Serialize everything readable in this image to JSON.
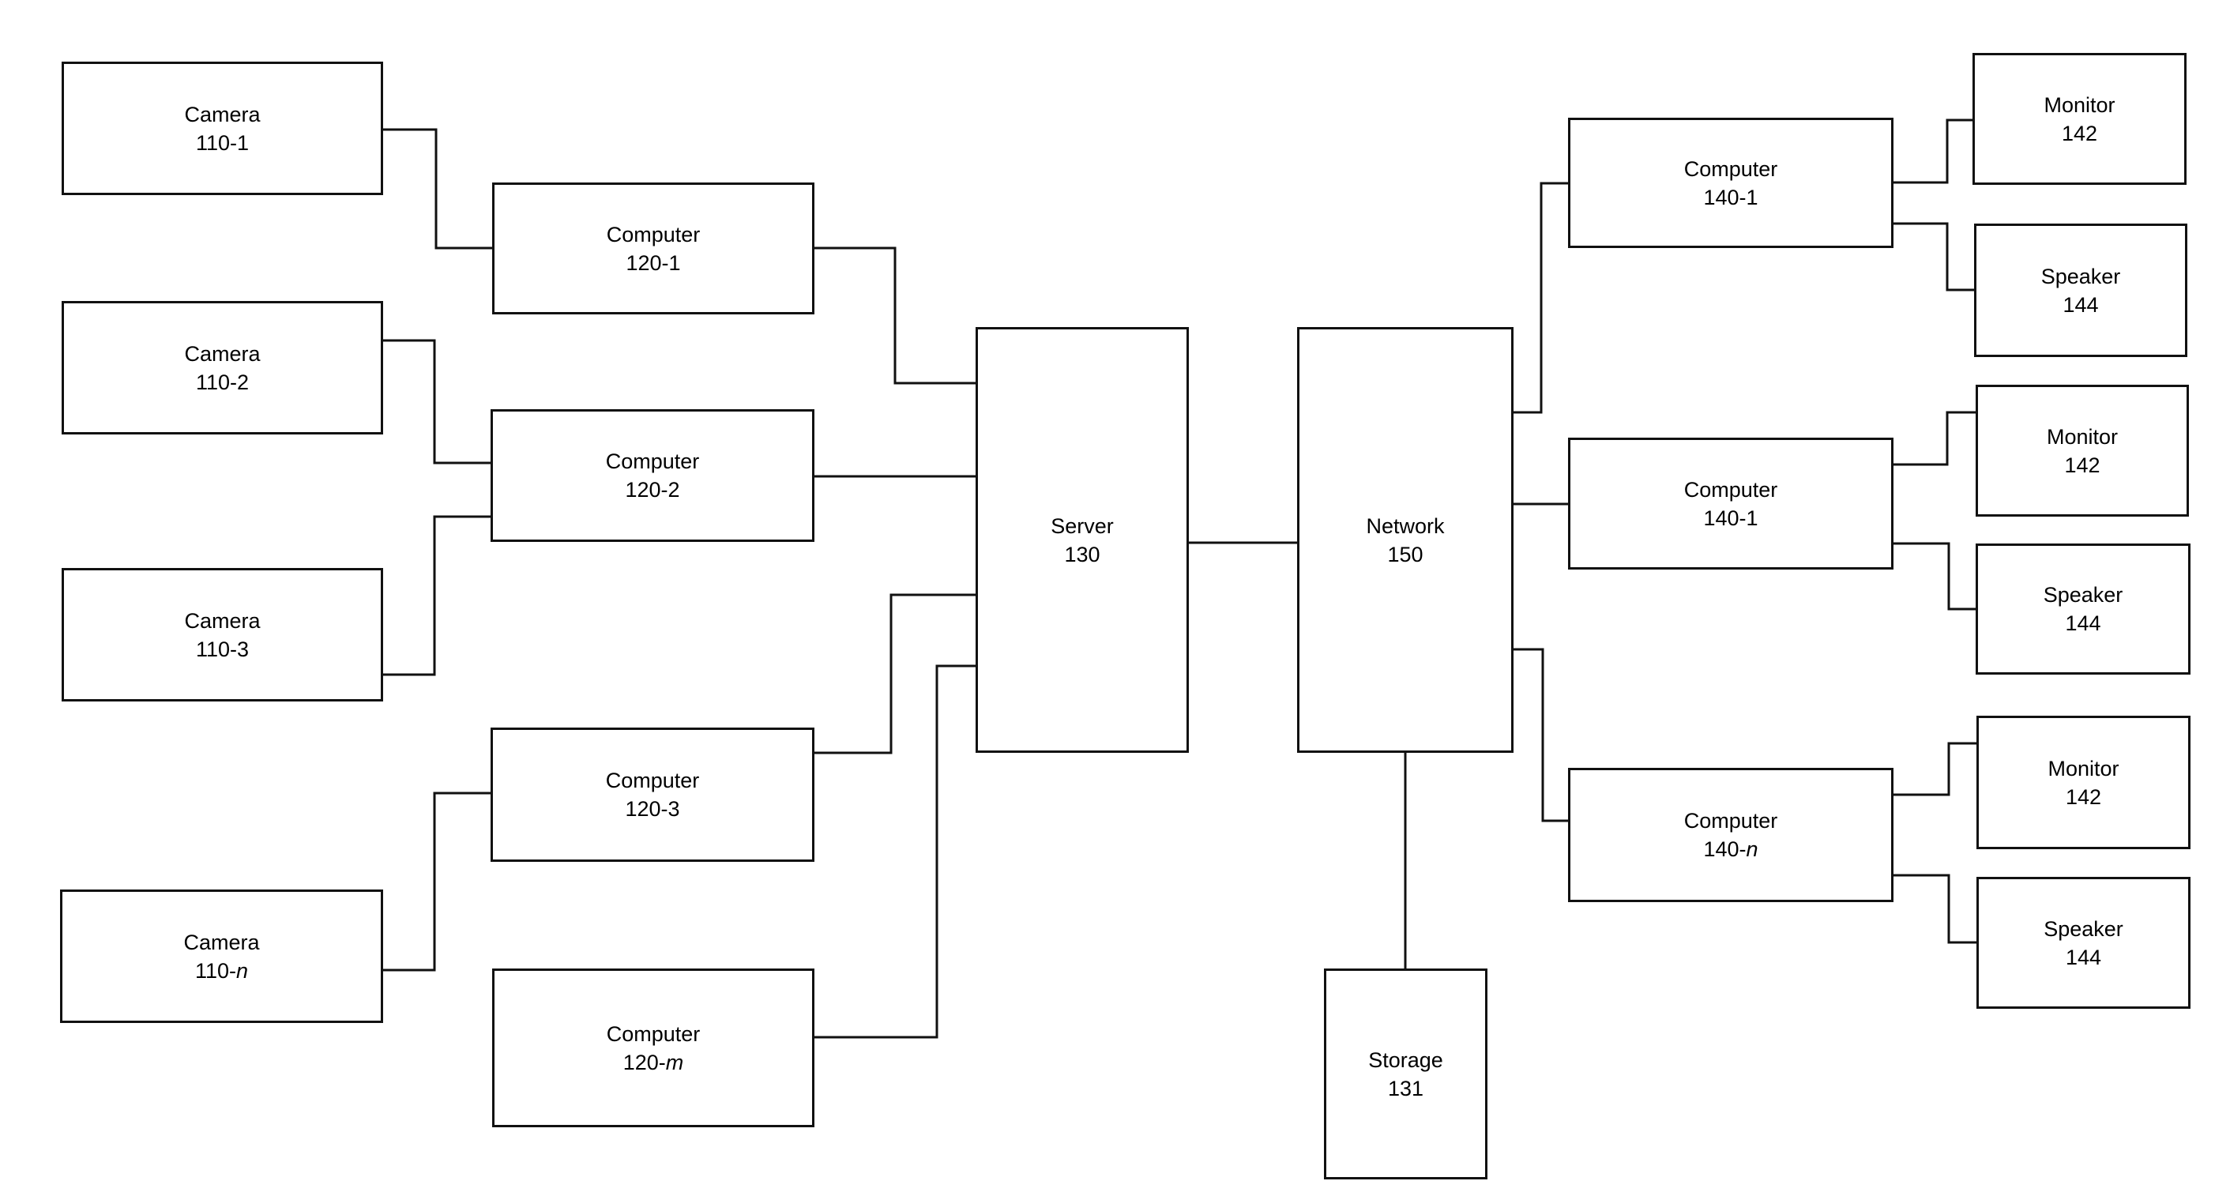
{
  "diagram": {
    "nodes": [
      {
        "id": "camera-110-1",
        "label": "Camera",
        "ref": "110-1"
      },
      {
        "id": "camera-110-2",
        "label": "Camera",
        "ref": "110-2"
      },
      {
        "id": "camera-110-3",
        "label": "Camera",
        "ref": "110-3"
      },
      {
        "id": "camera-110-n",
        "label": "Camera",
        "ref": "110-n"
      },
      {
        "id": "computer-120-1",
        "label": "Computer",
        "ref": "120-1"
      },
      {
        "id": "computer-120-2",
        "label": "Computer",
        "ref": "120-2"
      },
      {
        "id": "computer-120-3",
        "label": "Computer",
        "ref": "120-3"
      },
      {
        "id": "computer-120-m",
        "label": "Computer",
        "ref": "120-m"
      },
      {
        "id": "server-130",
        "label": "Server",
        "ref": "130"
      },
      {
        "id": "network-150",
        "label": "Network",
        "ref": "150"
      },
      {
        "id": "storage-131",
        "label": "Storage",
        "ref": "131"
      },
      {
        "id": "computer-140-1a",
        "label": "Computer",
        "ref": "140-1"
      },
      {
        "id": "computer-140-1b",
        "label": "Computer",
        "ref": "140-1"
      },
      {
        "id": "computer-140-n",
        "label": "Computer",
        "ref": "140-n"
      },
      {
        "id": "monitor-142a",
        "label": "Monitor",
        "ref": "142"
      },
      {
        "id": "speaker-144a",
        "label": "Speaker",
        "ref": "144"
      },
      {
        "id": "monitor-142b",
        "label": "Monitor",
        "ref": "142"
      },
      {
        "id": "speaker-144b",
        "label": "Speaker",
        "ref": "144"
      },
      {
        "id": "monitor-142c",
        "label": "Monitor",
        "ref": "142"
      },
      {
        "id": "speaker-144c",
        "label": "Speaker",
        "ref": "144"
      }
    ],
    "edges": [
      [
        "camera-110-1",
        "computer-120-1"
      ],
      [
        "camera-110-2",
        "computer-120-2"
      ],
      [
        "camera-110-3",
        "computer-120-2"
      ],
      [
        "camera-110-n",
        "computer-120-3"
      ],
      [
        "computer-120-1",
        "server-130"
      ],
      [
        "computer-120-2",
        "server-130"
      ],
      [
        "computer-120-3",
        "server-130"
      ],
      [
        "computer-120-m",
        "server-130"
      ],
      [
        "server-130",
        "network-150"
      ],
      [
        "network-150",
        "storage-131"
      ],
      [
        "network-150",
        "computer-140-1a"
      ],
      [
        "network-150",
        "computer-140-1b"
      ],
      [
        "network-150",
        "computer-140-n"
      ],
      [
        "computer-140-1a",
        "monitor-142a"
      ],
      [
        "computer-140-1a",
        "speaker-144a"
      ],
      [
        "computer-140-1b",
        "monitor-142b"
      ],
      [
        "computer-140-1b",
        "speaker-144b"
      ],
      [
        "computer-140-n",
        "monitor-142c"
      ],
      [
        "computer-140-n",
        "speaker-144c"
      ]
    ]
  }
}
